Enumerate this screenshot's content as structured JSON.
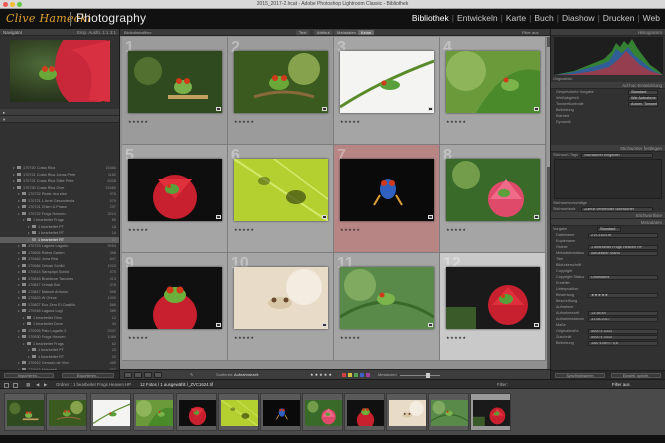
{
  "window": {
    "title": "2015_2017-2.lrcat - Adobe Photoshop Lightroom Classic - Bibliothek"
  },
  "identity": {
    "logo": "Clive Hamecki",
    "product": "Photography"
  },
  "modules": [
    {
      "label": "Bibliothek",
      "active": true
    },
    {
      "label": "Entwickeln",
      "active": false
    },
    {
      "label": "Karte",
      "active": false
    },
    {
      "label": "Buch",
      "active": false
    },
    {
      "label": "Diashow",
      "active": false
    },
    {
      "label": "Drucken",
      "active": false
    },
    {
      "label": "Web",
      "active": false
    }
  ],
  "navigator": {
    "title": "Navigator",
    "zoom": "Einp.   Ausfü.   1:1   3:1"
  },
  "folders": [
    {
      "name": "170720 Costa Rica",
      "count": "15460",
      "depth": 1
    },
    {
      "name": "170721 Costa Rica Jonas Pete",
      "count": "1162",
      "depth": 1
    },
    {
      "name": "170721 Costa Rica Silke Pete",
      "count": "6328",
      "depth": 1
    },
    {
      "name": "170730 Costa Rica Over",
      "count": "15460",
      "depth": 1
    },
    {
      "name": "170722 Pirate rica else",
      "count": "376",
      "depth": 2
    },
    {
      "name": "170721 1 Arne Gesundesta",
      "count": "579",
      "depth": 2
    },
    {
      "name": "170721 Chien & Phase",
      "count": "297",
      "depth": 2
    },
    {
      "name": "170722 Frogs Heaven",
      "count": "3210",
      "depth": 2
    },
    {
      "name": "1 bearbeitet Frogs",
      "count": "69",
      "depth": 3
    },
    {
      "name": "1 bearbeitet PT",
      "count": "18",
      "depth": 4
    },
    {
      "name": "1 bearbeitet RT",
      "count": "10",
      "depth": 4
    },
    {
      "name": "1 bearbeitet RT",
      "count": "12",
      "depth": 4,
      "selected": true
    },
    {
      "name": "170723 Laguna Lagarto",
      "count": "3050",
      "depth": 2
    },
    {
      "name": "170624 Rafna Garten",
      "count": "368",
      "depth": 2
    },
    {
      "name": "170462 Jona Kitsi",
      "count": "847",
      "depth": 2
    },
    {
      "name": "170684 Orinab Schild",
      "count": "1023",
      "depth": 2
    },
    {
      "name": "170814 Sarapiqui Schild",
      "count": "875",
      "depth": 2
    },
    {
      "name": "170815 Brabitone Tarcoles",
      "count": "413",
      "depth": 2
    },
    {
      "name": "170817 Orinab Bai",
      "count": "378",
      "depth": 2
    },
    {
      "name": "170817 Manuel Antonio",
      "count": "596",
      "depth": 2
    },
    {
      "name": "170823 W Orinal",
      "count": "1400",
      "depth": 2
    },
    {
      "name": "170827 Eco Zero El Castillo",
      "count": "886",
      "depth": 2
    },
    {
      "name": "170918 Laguna Lagi",
      "count": "389",
      "depth": 2
    },
    {
      "name": "1 bearbeitet Gem",
      "count": "12",
      "depth": 3
    },
    {
      "name": "1 bearbeitet Dove",
      "count": "44",
      "depth": 3
    },
    {
      "name": "170925 Palo Lagarto 2",
      "count": "2047",
      "depth": 2
    },
    {
      "name": "170930 Frogs Heaven",
      "count": "1069",
      "depth": 2
    },
    {
      "name": "1 bearbeitet Frogs",
      "count": "62",
      "depth": 3
    },
    {
      "name": "1 bearbeitet PT",
      "count": "23",
      "depth": 4
    },
    {
      "name": "1 bearbeitet RT",
      "count": "20",
      "depth": 4
    },
    {
      "name": "170912 Cerrado de Vinc",
      "count": "489",
      "depth": 2
    },
    {
      "name": "170915 Mahpiedi",
      "count": "502",
      "depth": 2
    },
    {
      "name": "MePro",
      "count": "86",
      "depth": 2
    },
    {
      "name": "Infrane Fotos",
      "count": "1031",
      "depth": 2
    }
  ],
  "left_buttons": {
    "import": "Importieren...",
    "export": "Exportieren..."
  },
  "filter_bar": {
    "label": "Bibliotheksfilter:",
    "segments": [
      "Text",
      "Attribut",
      "Metadaten",
      "Keine"
    ],
    "active": "Keine",
    "preset": "Filter aus"
  },
  "grid": [
    {
      "num": "1",
      "state": "dim",
      "stars": "★★★★★"
    },
    {
      "num": "2",
      "state": "dim",
      "stars": "★★★★★"
    },
    {
      "num": "3",
      "state": "normal",
      "stars": "★★★★★"
    },
    {
      "num": "4",
      "state": "normal",
      "stars": "★★★★★"
    },
    {
      "num": "5",
      "state": "normal",
      "stars": "★★★★★"
    },
    {
      "num": "6",
      "state": "normal",
      "stars": "★★★★★"
    },
    {
      "num": "7",
      "state": "red",
      "stars": "★★★★★"
    },
    {
      "num": "8",
      "state": "normal",
      "stars": "★★★★★"
    },
    {
      "num": "9",
      "state": "normal",
      "stars": "★★★★★"
    },
    {
      "num": "10",
      "state": "normal",
      "stars": "★★★★★"
    },
    {
      "num": "11",
      "state": "normal",
      "stars": "★★★★★"
    },
    {
      "num": "12",
      "state": "sel",
      "stars": "★★★★★"
    }
  ],
  "histogram": {
    "title": "Histogramm",
    "original": "Originalfoto"
  },
  "quick_develop": {
    "title": "Ad-hoc-Entwicklung",
    "rows": [
      {
        "k": "Gespeicherte Vorgabe",
        "v": "Standard"
      },
      {
        "k": "Weißabgleich",
        "v": "Wie Aufnahme"
      },
      {
        "k": "Tonwertkontrolle",
        "v": "Autom. Tonwert"
      },
      {
        "k": "Belichtung",
        "v": ""
      },
      {
        "k": "Klarheit",
        "v": ""
      },
      {
        "k": "Dynamik",
        "v": ""
      }
    ]
  },
  "keywording": {
    "title": "Stichwörter festlegen",
    "tags_label": "Stichwort-Tags",
    "tags_value": "Stichwörter eingeben",
    "suggest": "Stichwortvorschläge",
    "set_label": "Stichwortsatz",
    "set_value": "Zuletzt verwendet Stichwörter"
  },
  "keyword_list": {
    "title": "Stichwortliste"
  },
  "metadata": {
    "title": "Metadaten",
    "preset_label": "Standard",
    "preset_value": "Vorgabe",
    "rows": [
      {
        "k": "Dateiname",
        "v": "ZVC1624.tif"
      },
      {
        "k": "Kopiename",
        "v": ""
      },
      {
        "k": "Ordner",
        "v": "1 bearbeitet Frogs Heaven HP"
      },
      {
        "k": "Metadatenstatus",
        "v": "Aktuellster Stand"
      },
      {
        "k": "Titel",
        "v": ""
      },
      {
        "k": "Bildunterschrift",
        "v": ""
      },
      {
        "k": "Copyright",
        "v": ""
      },
      {
        "k": "Copyright-Status",
        "v": "Unbekannt"
      },
      {
        "k": "Ersteller",
        "v": ""
      },
      {
        "k": "Unterposition",
        "v": ""
      },
      {
        "k": "Bewertung",
        "v": "★★★★★"
      },
      {
        "k": "Beschriftung",
        "v": ""
      },
      {
        "k": "Aufnahme",
        "v": ""
      },
      {
        "k": "Aufnahmezeit",
        "v": "13:38:49"
      },
      {
        "k": "Aufnahmedatum",
        "v": "31.08.2017"
      },
      {
        "k": "Maße",
        "v": ""
      },
      {
        "k": "Originalmaße",
        "v": "5000 x 3333"
      },
      {
        "k": "Zuschnitt",
        "v": "5000 x 3333"
      },
      {
        "k": "Belichtung",
        "v": "1/60 s bei f / 5,6"
      }
    ]
  },
  "right_buttons": {
    "sync": "Synchronisieren",
    "sync_settings": "Einstell. synchr."
  },
  "toolbar": {
    "sort_label": "Sortieren:",
    "sort_value": "Aufnahmezeit",
    "rating": "★★★★★",
    "thumbs_label": "Miniaturen"
  },
  "filmstrip_header": {
    "path": "Ordner : 1 bearbeitet Frogs Heaven HP",
    "count": "12 Fotos / 1 ausgewählt /_ZVC1624.tif",
    "filter_label": "Filter:",
    "filter_value": "Filter aus"
  },
  "label_colors": [
    "#d04040",
    "#d0c040",
    "#50a050",
    "#4060c0",
    "#a040a0"
  ]
}
